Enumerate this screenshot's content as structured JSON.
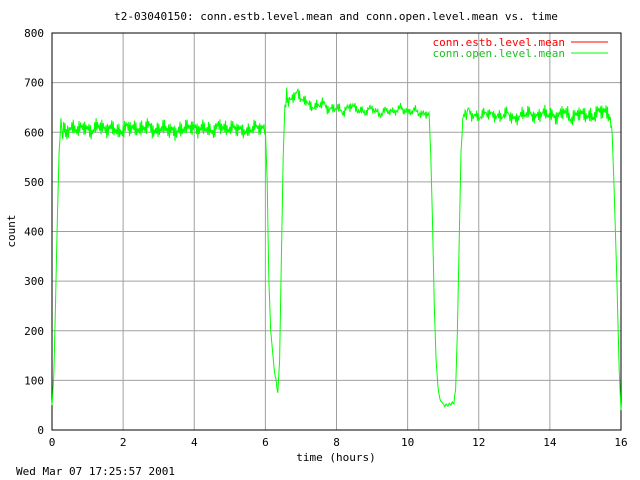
{
  "footer": {
    "timestamp": "Wed Mar 07 17:25:57 2001"
  },
  "chart_data": {
    "type": "line",
    "title": "t2-03040150: conn.estb.level.mean and conn.open.level.mean vs. time",
    "xlabel": "time (hours)",
    "ylabel": "count",
    "xlim": [
      0,
      16
    ],
    "ylim": [
      0,
      800
    ],
    "xticks": [
      0,
      2,
      4,
      6,
      8,
      10,
      12,
      14,
      16
    ],
    "yticks": [
      0,
      100,
      200,
      300,
      400,
      500,
      600,
      700,
      800
    ],
    "grid": true,
    "legend_position": "top-right",
    "series": [
      {
        "name": "conn.estb.level.mean",
        "color": "#ff0000",
        "x": [],
        "y": []
      },
      {
        "name": "conn.open.level.mean",
        "color": "#00ff00",
        "x": [
          0.0,
          0.05,
          0.1,
          0.15,
          0.2,
          0.25,
          0.3,
          0.35,
          0.4,
          0.5,
          0.7,
          0.9,
          1.1,
          1.3,
          1.5,
          1.7,
          1.9,
          2.1,
          2.3,
          2.5,
          2.7,
          2.9,
          3.1,
          3.3,
          3.5,
          3.7,
          3.9,
          4.1,
          4.3,
          4.5,
          4.7,
          4.9,
          5.1,
          5.3,
          5.5,
          5.7,
          5.9,
          6.0,
          6.05,
          6.1,
          6.15,
          6.2,
          6.25,
          6.3,
          6.35,
          6.4,
          6.45,
          6.5,
          6.55,
          6.6,
          6.65,
          6.7,
          6.8,
          6.9,
          7.0,
          7.1,
          7.2,
          7.4,
          7.6,
          7.8,
          8.0,
          8.2,
          8.4,
          8.6,
          8.8,
          9.0,
          9.2,
          9.4,
          9.6,
          9.8,
          10.0,
          10.2,
          10.4,
          10.6,
          10.65,
          10.7,
          10.75,
          10.8,
          10.85,
          10.9,
          10.95,
          11.0,
          11.1,
          11.2,
          11.3,
          11.35,
          11.4,
          11.45,
          11.5,
          11.55,
          11.6,
          11.65,
          11.7,
          11.8,
          12.0,
          12.2,
          12.4,
          12.6,
          12.8,
          13.0,
          13.2,
          13.4,
          13.6,
          13.8,
          14.0,
          14.2,
          14.4,
          14.6,
          14.8,
          15.0,
          15.2,
          15.4,
          15.6,
          15.7,
          15.75,
          15.8,
          15.85,
          15.9,
          15.95,
          16.0
        ],
        "y": [
          50,
          110,
          260,
          420,
          560,
          615,
          600,
          605,
          595,
          610,
          605,
          612,
          600,
          615,
          605,
          610,
          598,
          612,
          608,
          605,
          615,
          600,
          610,
          605,
          600,
          608,
          612,
          605,
          610,
          600,
          615,
          605,
          610,
          605,
          600,
          612,
          608,
          605,
          500,
          300,
          200,
          160,
          120,
          100,
          75,
          140,
          350,
          550,
          650,
          680,
          660,
          670,
          665,
          690,
          660,
          670,
          655,
          650,
          660,
          645,
          650,
          640,
          655,
          645,
          640,
          650,
          635,
          645,
          640,
          650,
          640,
          645,
          635,
          640,
          560,
          420,
          250,
          140,
          90,
          65,
          55,
          50,
          50,
          52,
          55,
          80,
          200,
          380,
          560,
          620,
          640,
          630,
          645,
          635,
          630,
          640,
          635,
          630,
          640,
          625,
          635,
          640,
          630,
          640,
          635,
          630,
          645,
          625,
          640,
          635,
          630,
          645,
          640,
          630,
          600,
          500,
          380,
          260,
          120,
          40
        ]
      }
    ]
  }
}
